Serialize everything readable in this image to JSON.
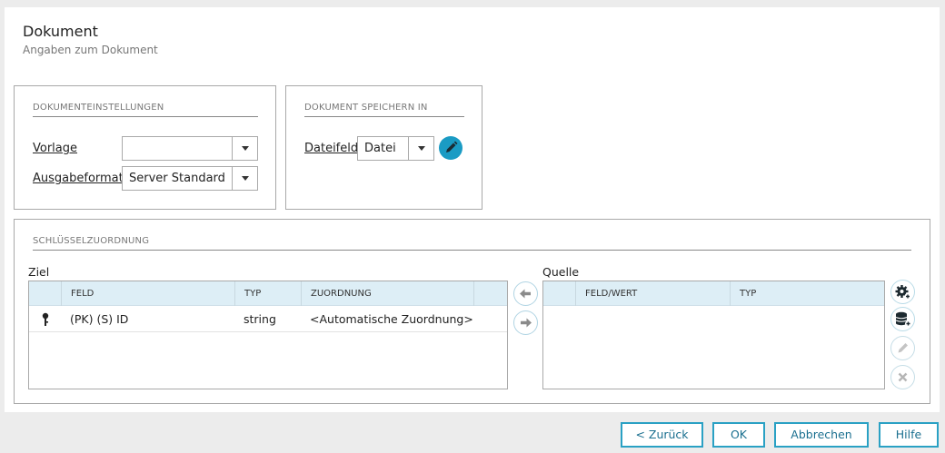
{
  "header": {
    "title": "Dokument",
    "subtitle": "Angaben zum Dokument"
  },
  "settings": {
    "legend": "DOKUMENTEINSTELLUNGEN",
    "vorlage_label": "Vorlage",
    "vorlage_value": "",
    "ausgabeformat_label": "Ausgabeformat",
    "ausgabeformat_value": "Server Standard"
  },
  "save": {
    "legend": "DOKUMENT SPEICHERN IN",
    "dateifeld_label": "Dateifeld",
    "dateifeld_value": "Datei"
  },
  "keymap": {
    "legend": "SCHLÜSSELZUORDNUNG",
    "ziel": {
      "label": "Ziel",
      "columns": [
        "FELD",
        "TYP",
        "ZUORDNUNG"
      ],
      "rows": [
        {
          "feld": "(PK) (S) ID",
          "typ": "string",
          "zuordnung": "<Automatische Zuordnung>"
        }
      ]
    },
    "quelle": {
      "label": "Quelle",
      "columns": [
        "FELD/WERT",
        "TYP"
      ],
      "rows": []
    }
  },
  "footer": {
    "back": "< Zurück",
    "ok": "OK",
    "cancel": "Abbrechen",
    "help": "Hilfe"
  },
  "colors": {
    "accent": "#1a9bc4",
    "header_bg": "#ddeef6"
  }
}
